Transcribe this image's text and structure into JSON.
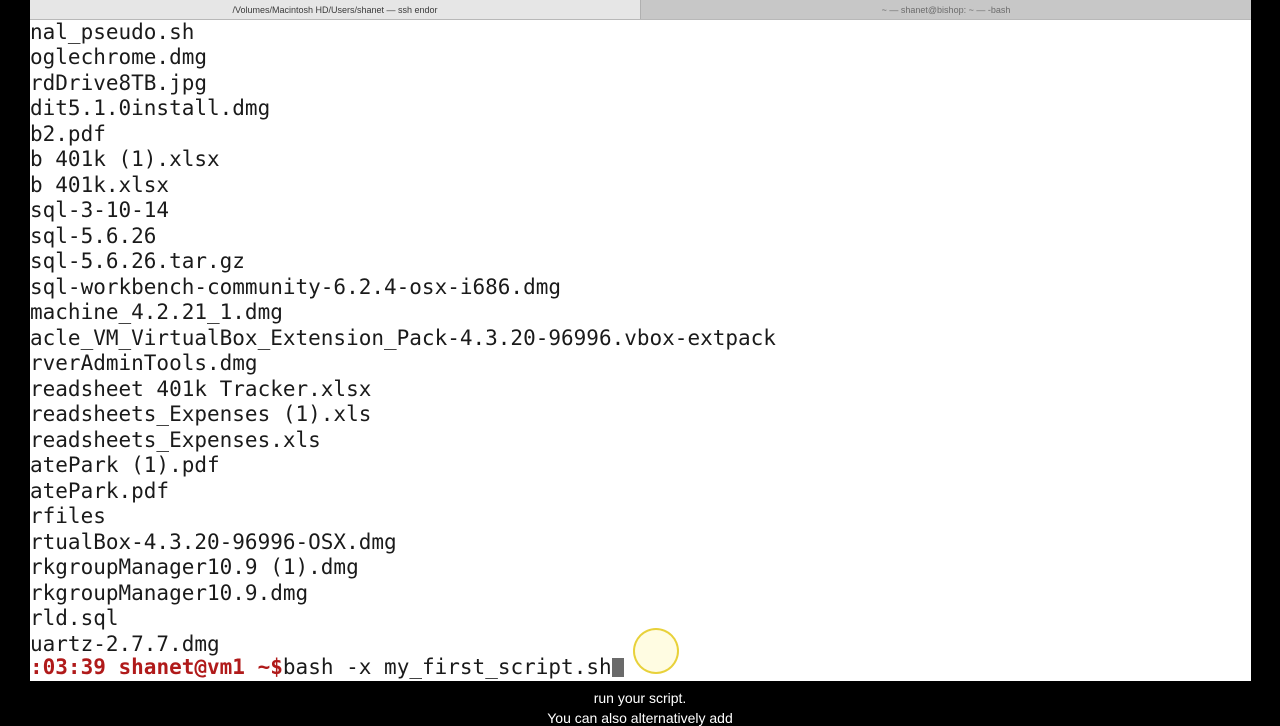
{
  "window": {
    "tab_active": "/Volumes/Macintosh HD/Users/shanet — ssh endor",
    "tab_inactive": "~ — shanet@bishop: ~ — -bash"
  },
  "terminal": {
    "lines": [
      "nal_pseudo.sh",
      "oglechrome.dmg",
      "rdDrive8TB.jpg",
      "dit5.1.0install.dmg",
      "b2.pdf",
      "b 401k (1).xlsx",
      "b 401k.xlsx",
      "sql-3-10-14",
      "sql-5.6.26",
      "sql-5.6.26.tar.gz",
      "sql-workbench-community-6.2.4-osx-i686.dmg",
      "machine_4.2.21_1.dmg",
      "acle_VM_VirtualBox_Extension_Pack-4.3.20-96996.vbox-extpack",
      "rverAdminTools.dmg",
      "readsheet 401k Tracker.xlsx",
      "readsheets_Expenses (1).xls",
      "readsheets_Expenses.xls",
      "atePark (1).pdf",
      "atePark.pdf",
      "rfiles",
      "rtualBox-4.3.20-96996-OSX.dmg",
      "rkgroupManager10.9 (1).dmg",
      "rkgroupManager10.9.dmg",
      "rld.sql",
      "uartz-2.7.7.dmg"
    ],
    "prompt": {
      "time": ":03:39",
      "user_host": "shanet@vm1",
      "path": "~$",
      "command": "bash -x my_first_script.sh"
    },
    "colors": {
      "prompt": "#b01a1a",
      "text": "#1a1a1a",
      "background": "#ffffff"
    }
  },
  "caption": {
    "line1": "run your script.",
    "line2": "You can also alternatively add"
  }
}
